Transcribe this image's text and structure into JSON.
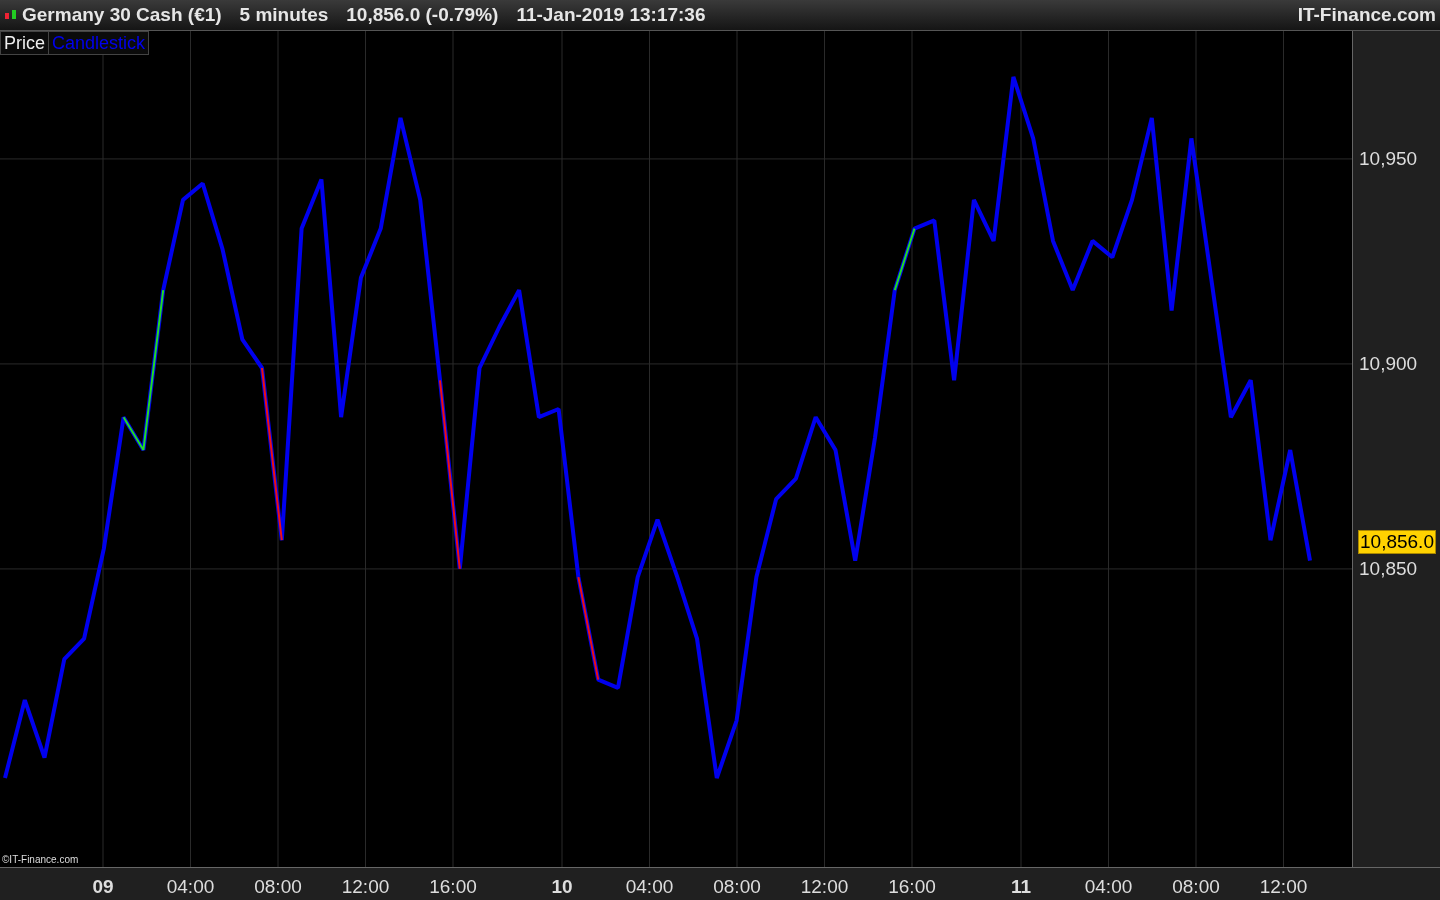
{
  "header": {
    "instrument": "Germany 30 Cash (€1)",
    "timeframe": "5 minutes",
    "quote": "10,856.0 (-0.79%)",
    "datetime": "11-Jan-2019 13:17:36",
    "brand": "IT-Finance.com"
  },
  "legend": [
    {
      "label": "Price",
      "kind": "name"
    },
    {
      "label": "Candlestick",
      "kind": "style"
    }
  ],
  "copyright": "©IT-Finance.com",
  "price_tag": "10,856.0",
  "x_axis": [
    {
      "label": "09",
      "kind": "day"
    },
    {
      "label": "04:00",
      "kind": "time"
    },
    {
      "label": "08:00",
      "kind": "time"
    },
    {
      "label": "12:00",
      "kind": "time"
    },
    {
      "label": "16:00",
      "kind": "time"
    },
    {
      "label": "10",
      "kind": "day"
    },
    {
      "label": "04:00",
      "kind": "time"
    },
    {
      "label": "08:00",
      "kind": "time"
    },
    {
      "label": "12:00",
      "kind": "time"
    },
    {
      "label": "16:00",
      "kind": "time"
    },
    {
      "label": "11",
      "kind": "day"
    },
    {
      "label": "04:00",
      "kind": "time"
    },
    {
      "label": "08:00",
      "kind": "time"
    },
    {
      "label": "12:00",
      "kind": "time"
    }
  ],
  "chart_data": {
    "type": "line",
    "grid": true,
    "ylim": [
      10777.3,
      10981.2
    ],
    "categories": [
      null,
      null,
      null,
      null,
      null,
      null,
      null,
      null,
      null,
      null,
      null,
      null,
      null,
      null,
      null,
      null,
      null,
      null,
      null,
      null,
      null,
      null,
      null,
      null,
      null,
      null,
      null,
      null,
      null,
      null,
      null,
      null,
      null,
      null,
      null,
      null,
      null,
      null,
      null,
      null,
      null,
      null,
      null,
      null,
      null,
      null,
      null,
      null,
      null,
      null,
      null,
      null,
      null,
      null,
      null,
      null,
      null,
      null,
      null,
      null,
      null,
      null,
      null,
      null,
      null,
      null,
      null
    ],
    "series": [
      {
        "color": "#0000ee",
        "values": [
          10799,
          10818,
          10804,
          10828,
          10833,
          10855,
          10887,
          10879,
          10918,
          10940,
          10944,
          10928,
          10906,
          10899,
          10857,
          10933,
          10945,
          10887,
          10921,
          10933,
          10960,
          10940,
          10896,
          10850,
          10899,
          10909,
          10918,
          10887,
          10889,
          10848,
          10823,
          10821,
          10848,
          10862,
          10848,
          10833,
          10799,
          10813,
          10848,
          10867,
          10872,
          10887,
          10879,
          10852,
          10882,
          10918,
          10933,
          10935,
          10896,
          10940,
          10930,
          10970,
          10955,
          10930,
          10918,
          10930,
          10926,
          10940,
          10960,
          10913,
          10955,
          10921,
          10887,
          10896,
          10857,
          10879,
          10852
        ]
      },
      {
        "color": "#22dd22",
        "values": [
          null,
          null,
          null,
          null,
          null,
          null,
          10887,
          10879,
          10918,
          null,
          null,
          null,
          null,
          null,
          null,
          null,
          null,
          null,
          null,
          null,
          null,
          null,
          null,
          null,
          null,
          null,
          null,
          null,
          null,
          null,
          null,
          null,
          null,
          null,
          null,
          null,
          null,
          null,
          null,
          null,
          null,
          null,
          null,
          null,
          null,
          10918,
          10933,
          null,
          null,
          null,
          null,
          null,
          null,
          null,
          null,
          null,
          null,
          null,
          null,
          null,
          null,
          null,
          null,
          null,
          null,
          null,
          null
        ]
      },
      {
        "color": "#ee1111",
        "values": [
          null,
          null,
          null,
          null,
          null,
          null,
          null,
          null,
          null,
          null,
          null,
          null,
          null,
          10899,
          10857,
          null,
          null,
          null,
          null,
          null,
          null,
          null,
          10896,
          10850,
          null,
          null,
          null,
          null,
          null,
          10848,
          10823,
          null,
          null,
          null,
          null,
          null,
          null,
          null,
          null,
          null,
          null,
          null,
          null,
          null,
          null,
          null,
          null,
          null,
          null,
          null,
          null,
          null,
          null,
          null,
          null,
          null,
          null,
          null,
          null,
          null,
          null,
          null,
          null,
          null,
          null,
          null,
          null
        ]
      }
    ],
    "yticks": [
      {
        "value": 10950,
        "label": "10,950"
      },
      {
        "value": 10900,
        "label": "10,900"
      },
      {
        "value": 10850,
        "label": "10,850"
      }
    ]
  }
}
